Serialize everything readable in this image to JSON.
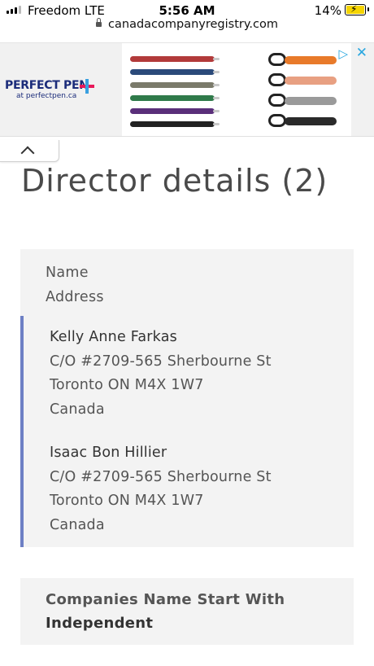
{
  "status_bar": {
    "carrier": "Freedom  LTE",
    "time": "5:56 AM",
    "battery_percent": "14%",
    "battery_level": 0.14,
    "icons": [
      "signal-bars-icon",
      "battery-charging-icon"
    ]
  },
  "browser": {
    "url": "canadacompanyregistry.com",
    "lock_icon": "lock-icon"
  },
  "ad": {
    "brand": "PERFECT PEN",
    "brand_sub": "at perfectpen.ca",
    "pen_colors": [
      "#b23a3a",
      "#2b4a7a",
      "#7a7a6a",
      "#2f7a4a",
      "#5a2f7a",
      "#222222"
    ],
    "carabiner_colors": [
      "#e87a2a",
      "#e8a082",
      "#9a9a9a",
      "#2a2a2a"
    ],
    "choices_icon": "ad-choices-icon",
    "close_icon": "close-icon"
  },
  "collapse": {
    "icon": "chevron-up-icon"
  },
  "page": {
    "title": "Director details (2)"
  },
  "directors_card": {
    "header": [
      "Name",
      "Address"
    ],
    "accent_color": "#6d7fc4",
    "directors": [
      {
        "name": "Kelly Anne Farkas",
        "address_lines": [
          "C/O #2709-565 Sherbourne St",
          "Toronto ON M4X 1W7",
          "Canada"
        ]
      },
      {
        "name": "Isaac Bon Hillier",
        "address_lines": [
          "C/O #2709-565 Sherbourne St",
          "Toronto ON M4X 1W7",
          "Canada"
        ]
      }
    ]
  },
  "companies_card": {
    "label": "Companies Name Start With",
    "value": "Independent"
  }
}
